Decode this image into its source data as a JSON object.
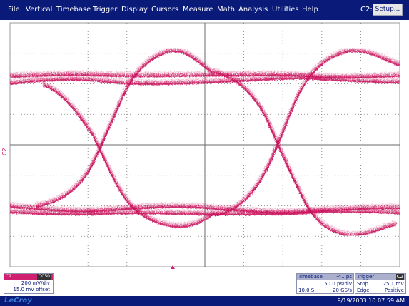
{
  "menubar": {
    "items": [
      "File",
      "Vertical",
      "Timebase",
      "Trigger",
      "Display",
      "Cursors",
      "Measure",
      "Math",
      "Analysis",
      "Utilities",
      "Help"
    ],
    "channel_label": "C2:",
    "setup_label": "Setup..."
  },
  "scope": {
    "channel_marker": "C2",
    "trace_color": "#c8105a"
  },
  "channel": {
    "name": "C2",
    "badge": "DC50",
    "volts_div": "200 mV/div",
    "offset": "15.0 mV offset",
    "color": "#d02070"
  },
  "timebase": {
    "label": "Timebase",
    "delay": "-41 ps",
    "time_div": "50.0 ps/div",
    "samples": "10.0 S",
    "rate": "20 GS/s"
  },
  "trigger": {
    "label": "Trigger",
    "channel": "C2",
    "mode": "Stop",
    "level": "25.1 mV",
    "type": "Edge",
    "slope": "Positive"
  },
  "status": {
    "brand": "LeCroy",
    "timestamp": "9/19/2003 10:07:59 AM"
  }
}
